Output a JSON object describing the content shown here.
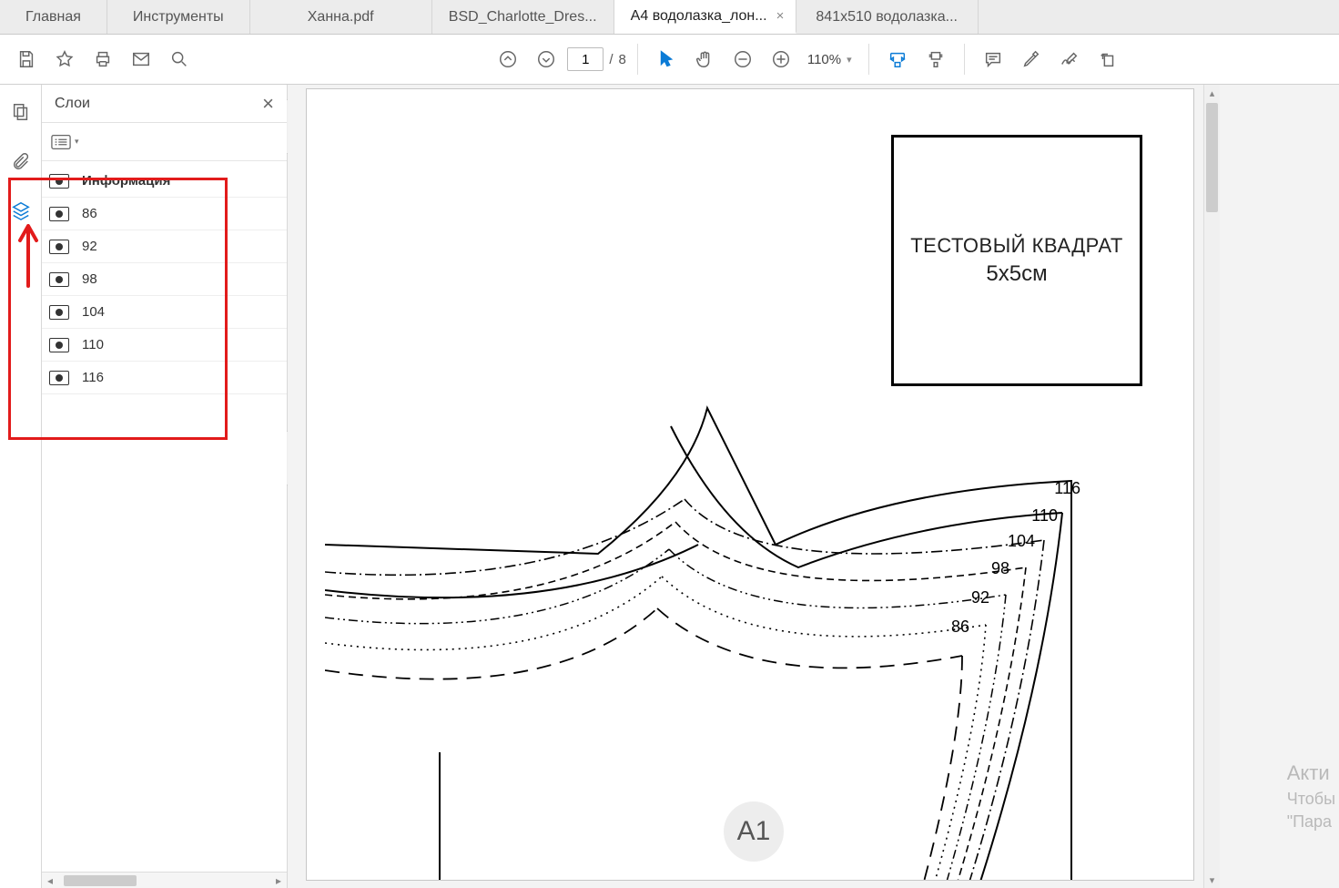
{
  "app_tabs": {
    "main": "Главная",
    "tools": "Инструменты"
  },
  "doc_tabs": [
    {
      "label": "Ханна.pdf",
      "active": false,
      "closable": false
    },
    {
      "label": "BSD_Charlotte_Dres...",
      "active": false,
      "closable": false
    },
    {
      "label": "А4  водолазка_лон...",
      "active": true,
      "closable": true
    },
    {
      "label": "841x510 водолазка...",
      "active": false,
      "closable": false
    }
  ],
  "pager": {
    "current": "1",
    "sep": "/",
    "total": "8"
  },
  "zoom": {
    "value": "110%"
  },
  "layers_panel": {
    "title": "Слои",
    "items": [
      {
        "name": "Информация",
        "bold": true
      },
      {
        "name": "86",
        "bold": false
      },
      {
        "name": "92",
        "bold": false
      },
      {
        "name": "98",
        "bold": false
      },
      {
        "name": "104",
        "bold": false
      },
      {
        "name": "110",
        "bold": false
      },
      {
        "name": "116",
        "bold": false
      }
    ]
  },
  "page_content": {
    "test_square_line1": "ТЕСТОВЫЙ КВАДРАТ",
    "test_square_line2": "5x5см",
    "a1_label": "A1",
    "size_labels": {
      "s116": "116",
      "s110": "110",
      "s104": "104",
      "s98": "98",
      "s92": "92",
      "s86": "86"
    }
  },
  "watermark": {
    "l1": "Акти",
    "l2": "Чтобы",
    "l3": "\"Пара"
  }
}
